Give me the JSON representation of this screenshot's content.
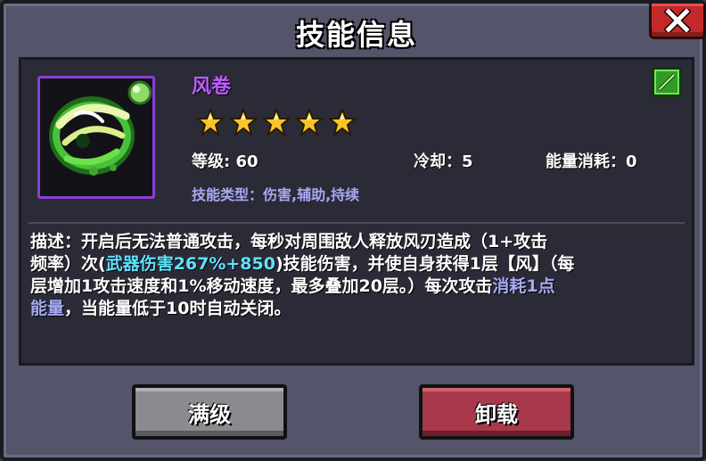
{
  "dialog": {
    "title": "技能信息",
    "close_icon": "close-x-icon"
  },
  "skill": {
    "name": "风卷",
    "icon": "wind-whirl-skill-icon",
    "stars": 5,
    "level": "等级: 60",
    "cooldown": "冷却：5",
    "energy": "能量消耗：0",
    "type": "技能类型：伤害,辅助,持续",
    "corner_icon": "green-equipped-icon"
  },
  "description": {
    "prefix": "描述：开启后无法普通攻击，每秒对周围敌人释放风刃造成（1+攻击",
    "line2_start": "频率）次(",
    "damage_highlight": "武器伤害267%+850",
    "line2_end": ")技能伤害，并使自身获得1层【风】（每",
    "line3_start": "层增加1攻击速度和1%移动速度，最多叠加20层。）每次攻击",
    "energy_highlight_a": "消耗1点",
    "energy_highlight_b": "能量",
    "suffix": "，当能量低于10时自动关闭。"
  },
  "buttons": {
    "max_label": "满级",
    "unload_label": "卸载"
  },
  "colors": {
    "skill_name": "#c05bff",
    "highlight_cyan": "#5fe2ff",
    "highlight_purple": "#a7a9f2",
    "star": "#f7c52b"
  }
}
